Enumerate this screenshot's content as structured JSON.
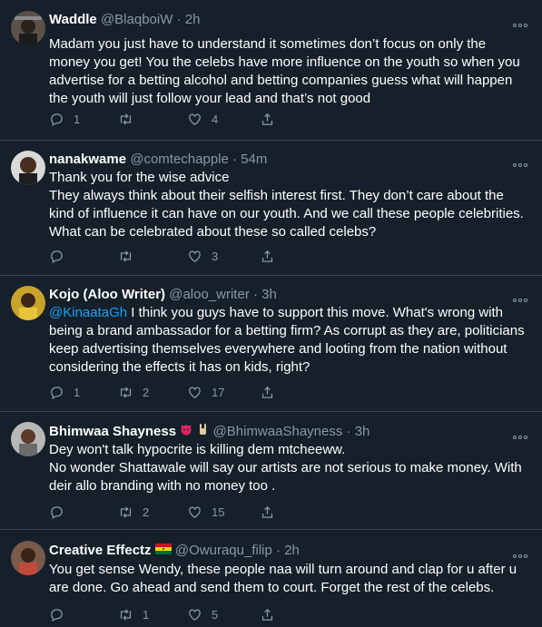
{
  "tweets": [
    {
      "name": "Waddle",
      "handle": "@BlaqboiW",
      "time": "2h",
      "mention": "",
      "text": "Madam you just have to understand it sometimes don’t focus on only the money you get! You the celebs have more influence on the youth so when you advertise for a betting alcohol and betting companies guess what will happen the youth will just follow your lead and that’s not good",
      "replies": "1",
      "retweets": "",
      "likes": "4"
    },
    {
      "name": "nanakwame",
      "handle": "@comtechapple",
      "time": "54m",
      "mention": "",
      "text": "Thank you for the wise advice\nThey always think about their selfish interest first. They don’t care about the kind of influence it can have on our youth. And we call these people celebrities. What can be celebrated about these so called celebs?",
      "replies": "",
      "retweets": "",
      "likes": "3"
    },
    {
      "name": "Kojo (Aloo Writer)",
      "handle": "@aloo_writer",
      "time": "3h",
      "mention": "@KinaataGh",
      "text": " I think you guys have to support this move. What's wrong with being a brand ambassador for a betting firm? As corrupt as they are, politicians keep advertising themselves everywhere and looting from the nation without considering the effects it has on kids, right?",
      "replies": "1",
      "retweets": "2",
      "likes": "17"
    },
    {
      "name": "Bhimwaa Shayness",
      "handle": "@BhimwaaShayness",
      "time": "3h",
      "mention": "",
      "text": "Dey won't talk hypocrite is killing dem mtcheeww.\nNo wonder Shattawale will say our artists are not serious to make money. With deir allo branding with no money too .",
      "replies": "",
      "retweets": "2",
      "likes": "15"
    },
    {
      "name": "Creative Effectz",
      "handle": "@Owuraqu_filip",
      "time": "2h",
      "mention": "",
      "text": "You get sense Wendy,  these people naa will turn around and clap for u after u are done.  Go ahead and send them to court.  Forget the rest of the celebs.",
      "replies": "",
      "retweets": "1",
      "likes": "5"
    }
  ],
  "separator": "·",
  "colors": {
    "background": "#15202b",
    "text": "#ffffff",
    "muted": "#8899a6",
    "link": "#1da1f2",
    "border": "#38444d"
  },
  "icons": [
    "reply-icon",
    "retweet-icon",
    "like-icon",
    "share-icon",
    "more-icon",
    "ghana-flag-icon",
    "devil-face-icon",
    "rock-hand-icon"
  ]
}
